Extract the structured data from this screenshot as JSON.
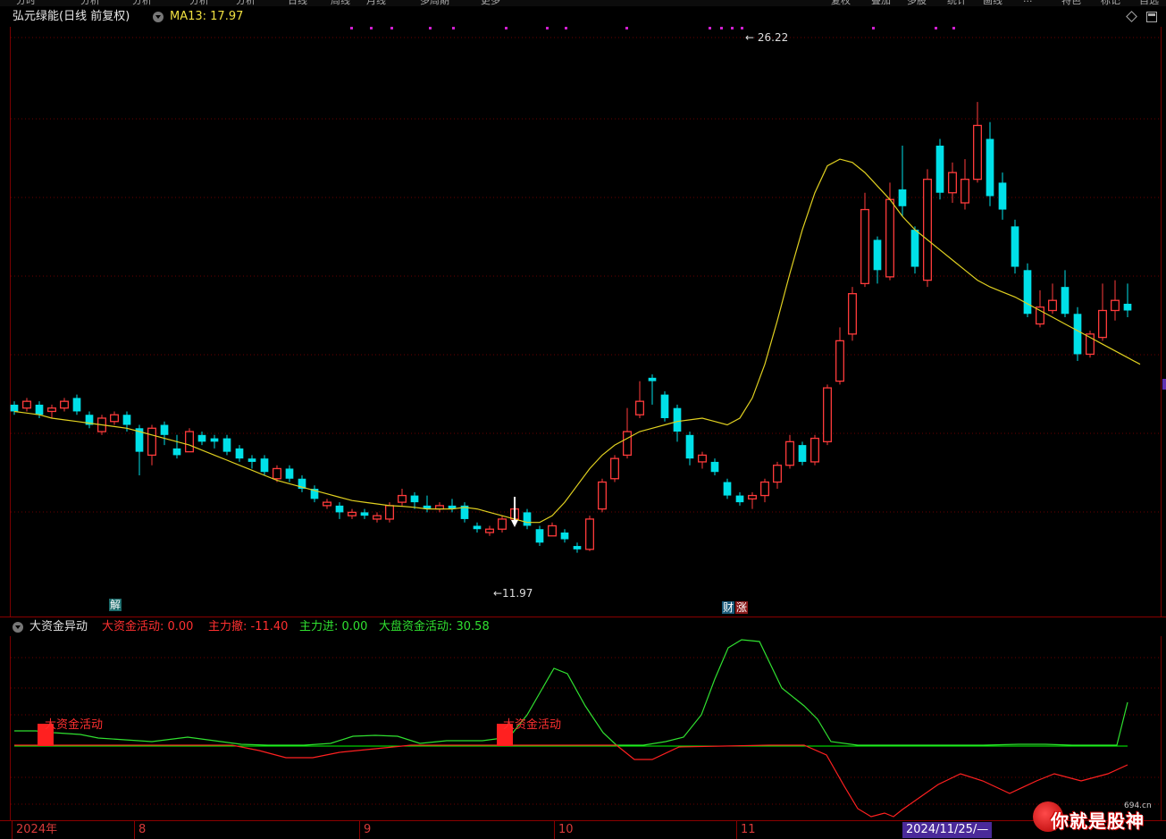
{
  "toolbar": {
    "items": [
      "分时",
      "分析",
      "分析",
      "分析",
      "分析",
      "日线",
      "周线",
      "月线",
      "多周期",
      "更多",
      "复权",
      "叠加",
      "多股",
      "统计",
      "画线",
      "...",
      "特色",
      "标记",
      "自选"
    ]
  },
  "main_panel": {
    "stock_title": "弘元绿能(日线 前复权)",
    "ma_label": "MA13: 17.97",
    "high_label": "26.22",
    "low_label": "11.97",
    "markers": {
      "jie": "解",
      "caizhang": "财",
      "caizhang2": "涨"
    }
  },
  "sub_panel": {
    "name": "大资金异动",
    "values": [
      {
        "text": "大资金活动: 0.00",
        "color": "#ff3030"
      },
      {
        "text": "主力撤: -11.40",
        "color": "#ff3030"
      },
      {
        "text": "主力进: 0.00",
        "color": "#30e030"
      },
      {
        "text": "大盘资金活动: 30.58",
        "color": "#30e030"
      }
    ],
    "annotation": "大资金活动"
  },
  "date_axis": {
    "ticks": [
      "2024年",
      "8",
      "9",
      "10",
      "11"
    ],
    "cursor": "2024/11/25/—"
  },
  "logo": {
    "text": "你就是股神",
    "small": "694.cn"
  },
  "colors": {
    "up": "#ff3b3b",
    "down": "#00e0e8",
    "ma": "#e0d020",
    "grid": "#6a0000",
    "green_line": "#30e030",
    "red_line": "#ff2020"
  },
  "chart_data": {
    "type": "candlestick",
    "ylim": [
      10.2,
      26.8
    ],
    "ma13": [
      15.5,
      15.45,
      15.4,
      15.3,
      15.25,
      15.2,
      15.15,
      15.1,
      15.05,
      15.0,
      14.9,
      14.8,
      14.7,
      14.6,
      14.5,
      14.35,
      14.2,
      14.05,
      13.9,
      13.75,
      13.6,
      13.45,
      13.35,
      13.25,
      13.15,
      13.05,
      12.95,
      12.85,
      12.8,
      12.75,
      12.7,
      12.68,
      12.65,
      12.6,
      12.6,
      12.6,
      12.65,
      12.6,
      12.5,
      12.4,
      12.3,
      12.2,
      12.2,
      12.4,
      12.8,
      13.3,
      13.8,
      14.2,
      14.5,
      14.7,
      14.9,
      15.0,
      15.1,
      15.2,
      15.25,
      15.3,
      15.2,
      15.1,
      15.3,
      15.9,
      16.9,
      18.2,
      19.6,
      20.9,
      22.0,
      22.8,
      23.0,
      22.9,
      22.6,
      22.2,
      21.8,
      21.3,
      20.9,
      20.6,
      20.3,
      20.0,
      19.7,
      19.4,
      19.2,
      19.05,
      18.9,
      18.7,
      18.5,
      18.3,
      18.1,
      17.9,
      17.7,
      17.5,
      17.3,
      17.1,
      16.9
    ],
    "candles": [
      [
        15.7,
        15.5,
        15.8,
        15.4
      ],
      [
        15.6,
        15.8,
        15.9,
        15.5
      ],
      [
        15.7,
        15.4,
        15.8,
        15.3
      ],
      [
        15.5,
        15.6,
        15.7,
        15.3
      ],
      [
        15.6,
        15.8,
        15.9,
        15.5
      ],
      [
        15.9,
        15.5,
        16.0,
        15.4
      ],
      [
        15.4,
        15.1,
        15.5,
        15.0
      ],
      [
        14.9,
        15.3,
        15.4,
        14.8
      ],
      [
        15.2,
        15.4,
        15.5,
        15.1
      ],
      [
        15.4,
        15.1,
        15.5,
        14.9
      ],
      [
        15.0,
        14.3,
        15.1,
        13.6
      ],
      [
        14.2,
        15.0,
        15.1,
        13.9
      ],
      [
        15.1,
        14.8,
        15.2,
        14.5
      ],
      [
        14.4,
        14.2,
        14.8,
        14.1
      ],
      [
        14.3,
        14.9,
        15.0,
        14.3
      ],
      [
        14.8,
        14.6,
        14.9,
        14.5
      ],
      [
        14.7,
        14.6,
        14.8,
        14.4
      ],
      [
        14.7,
        14.3,
        14.8,
        14.2
      ],
      [
        14.4,
        14.1,
        14.5,
        14.0
      ],
      [
        14.1,
        14.0,
        14.2,
        13.8
      ],
      [
        14.1,
        13.7,
        14.2,
        13.6
      ],
      [
        13.5,
        13.8,
        13.9,
        13.4
      ],
      [
        13.8,
        13.5,
        13.9,
        13.4
      ],
      [
        13.5,
        13.2,
        13.6,
        13.1
      ],
      [
        13.2,
        12.9,
        13.3,
        12.8
      ],
      [
        12.7,
        12.8,
        12.9,
        12.6
      ],
      [
        12.7,
        12.5,
        12.8,
        12.3
      ],
      [
        12.4,
        12.5,
        12.6,
        12.3
      ],
      [
        12.5,
        12.4,
        12.6,
        12.3
      ],
      [
        12.3,
        12.4,
        12.5,
        12.2
      ],
      [
        12.3,
        12.7,
        12.8,
        12.2
      ],
      [
        12.8,
        13.0,
        13.2,
        12.7
      ],
      [
        13.0,
        12.8,
        13.1,
        12.6
      ],
      [
        12.7,
        12.6,
        13.0,
        12.5
      ],
      [
        12.6,
        12.7,
        12.8,
        12.5
      ],
      [
        12.7,
        12.6,
        12.9,
        12.5
      ],
      [
        12.7,
        12.3,
        12.8,
        12.2
      ],
      [
        12.1,
        12.0,
        12.2,
        11.9
      ],
      [
        11.9,
        12.0,
        12.1,
        11.8
      ],
      [
        12.0,
        12.3,
        12.4,
        11.9
      ],
      [
        12.3,
        12.6,
        12.8,
        12.2
      ],
      [
        12.5,
        12.1,
        12.6,
        12.0
      ],
      [
        12.0,
        11.6,
        12.1,
        11.5
      ],
      [
        11.8,
        12.1,
        12.2,
        11.9
      ],
      [
        11.9,
        11.7,
        12.0,
        11.6
      ],
      [
        11.5,
        11.4,
        11.6,
        11.3
      ],
      [
        11.4,
        12.3,
        12.4,
        11.35
      ],
      [
        12.6,
        13.4,
        13.5,
        12.5
      ],
      [
        13.5,
        14.1,
        14.2,
        13.4
      ],
      [
        14.2,
        14.9,
        15.6,
        14.1
      ],
      [
        15.4,
        15.8,
        16.4,
        15.3
      ],
      [
        16.5,
        16.4,
        16.6,
        15.7
      ],
      [
        16.0,
        15.3,
        16.1,
        15.2
      ],
      [
        15.6,
        14.9,
        15.7,
        14.6
      ],
      [
        14.8,
        14.1,
        14.9,
        13.9
      ],
      [
        14.0,
        14.2,
        14.3,
        13.8
      ],
      [
        14.0,
        13.7,
        14.1,
        13.6
      ],
      [
        13.4,
        13.0,
        13.5,
        12.9
      ],
      [
        13.0,
        12.8,
        13.1,
        12.7
      ],
      [
        12.9,
        13.0,
        13.1,
        12.6
      ],
      [
        13.0,
        13.4,
        13.5,
        12.8
      ],
      [
        13.4,
        13.9,
        14.0,
        13.2
      ],
      [
        13.9,
        14.6,
        14.8,
        13.8
      ],
      [
        14.5,
        14.0,
        14.6,
        13.9
      ],
      [
        14.0,
        14.7,
        14.8,
        13.9
      ],
      [
        14.6,
        16.2,
        16.3,
        14.5
      ],
      [
        16.4,
        17.6,
        18.0,
        16.3
      ],
      [
        17.8,
        19.0,
        19.2,
        17.6
      ],
      [
        19.3,
        21.5,
        22.0,
        19.2
      ],
      [
        20.6,
        19.7,
        20.7,
        19.3
      ],
      [
        19.5,
        21.8,
        22.3,
        19.4
      ],
      [
        22.1,
        21.6,
        23.4,
        21.3
      ],
      [
        20.9,
        19.8,
        21.0,
        19.6
      ],
      [
        19.4,
        22.4,
        22.7,
        19.2
      ],
      [
        23.4,
        22.0,
        23.6,
        21.8
      ],
      [
        22.0,
        22.6,
        22.9,
        21.7
      ],
      [
        21.7,
        22.4,
        23.0,
        21.5
      ],
      [
        22.4,
        24.0,
        24.7,
        22.3
      ],
      [
        23.6,
        21.9,
        24.1,
        21.6
      ],
      [
        22.3,
        21.5,
        22.6,
        21.2
      ],
      [
        21.0,
        19.8,
        21.2,
        19.6
      ],
      [
        19.7,
        18.4,
        19.9,
        18.3
      ],
      [
        18.1,
        18.6,
        19.1,
        18.0
      ],
      [
        18.5,
        18.8,
        19.3,
        18.4
      ],
      [
        19.2,
        18.4,
        19.7,
        18.3
      ],
      [
        18.4,
        17.2,
        18.6,
        17.0
      ],
      [
        17.2,
        17.8,
        17.9,
        17.1
      ],
      [
        17.7,
        18.5,
        19.3,
        17.6
      ],
      [
        18.5,
        18.8,
        19.4,
        18.2
      ],
      [
        18.7,
        18.5,
        19.3,
        18.3
      ]
    ],
    "sub": {
      "ylim": [
        -12,
        14
      ],
      "green": [
        0.0,
        0.02,
        0.01,
        0.01,
        0.0,
        0.0,
        0.01,
        0.0,
        0.0,
        0.02,
        0.01,
        0.0,
        0.0,
        0.01,
        0.0,
        0.0,
        0.0,
        0.0,
        0.01,
        0.02,
        0.0,
        0.0,
        0.0,
        0.0,
        0.0,
        0.0,
        0.0,
        0.0,
        0.0,
        0.0,
        0.0,
        0.0,
        0.0,
        0.0,
        0.0,
        0.0,
        0.02,
        0.0,
        0.0,
        0.0,
        0.0,
        0.0,
        0.0,
        0.0,
        0.0,
        0.0,
        0.0,
        0.0,
        0.0,
        0.0,
        0.0,
        0.0,
        0.0,
        0.0,
        0.0,
        0.0,
        0.0,
        0.0,
        0.0,
        0.0,
        0.0,
        0.0,
        0.0,
        0.0,
        0.0,
        0.0,
        0.0,
        0.0,
        0.0,
        0.0,
        0.0,
        0.0,
        0.0,
        0.0,
        0.0,
        0.0,
        0.0,
        0.0,
        0.0,
        0.0,
        0.0,
        0.0,
        0.0,
        0.0,
        0.0,
        0.0,
        0.0,
        0.0,
        0.0,
        0.0,
        0.0,
        0.0
      ]
    }
  }
}
